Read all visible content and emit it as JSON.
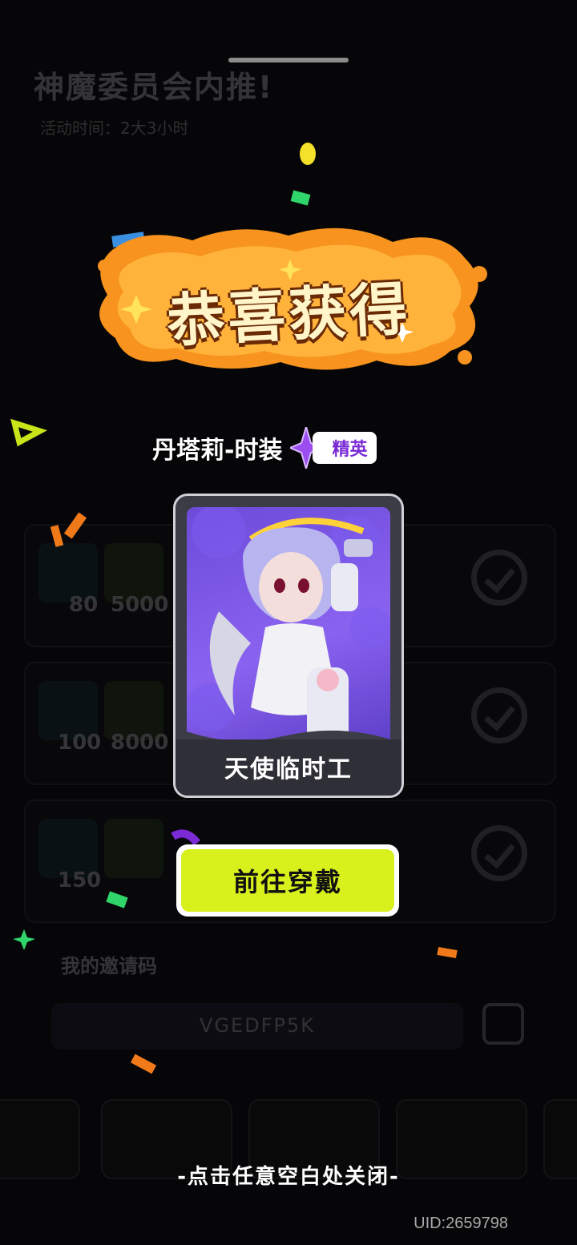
{
  "background_page": {
    "title": "神魔委员会内推!",
    "subtitle": "活动时间：2大3小时",
    "rewards": [
      {
        "gem_amount": "80",
        "coin_amount": "5000"
      },
      {
        "gem_amount": "100",
        "coin_amount": "8000"
      },
      {
        "gem_amount": "150",
        "coin_amount": ""
      }
    ],
    "invite_label": "我的邀请码",
    "invite_code": "VGEDFP5K"
  },
  "modal": {
    "headline": "恭喜获得",
    "item_name": "丹塔莉-时装",
    "rarity_badge": "精英",
    "card_title": "天使临时工",
    "primary_button": "前往穿戴",
    "close_hint": "-点击任意空白处关闭-"
  },
  "footer": {
    "uid": "UID:2659798"
  },
  "colors": {
    "accent_yellow": "#d8f01c",
    "splash_orange": "#f7931e",
    "rarity_purple": "#7a2bd6",
    "card_bg": "#7a55e6"
  }
}
